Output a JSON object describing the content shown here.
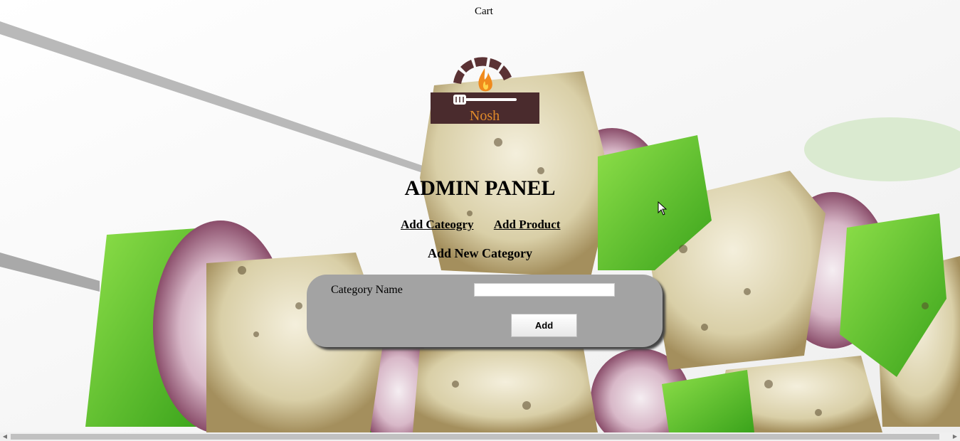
{
  "header": {
    "cart_label": "Cart"
  },
  "logo": {
    "brand": "Nosh"
  },
  "admin": {
    "title": "ADMIN PANEL",
    "nav": {
      "add_category_label": "Add Cateogry",
      "add_product_label": "Add Product"
    },
    "section_title": "Add New Category"
  },
  "form": {
    "category_name_label": "Category Name",
    "category_name_value": "",
    "add_button_label": "Add"
  },
  "colors": {
    "panel": "#a3a3a3",
    "logo_dark": "#4a2b2d",
    "logo_flame": "#f08a1c",
    "text": "#000000"
  },
  "icons": {
    "logo": "nosh-logo-icon",
    "scroll_left": "scroll-left-arrow-icon",
    "scroll_right": "scroll-right-arrow-icon",
    "cursor": "mouse-pointer-icon"
  }
}
